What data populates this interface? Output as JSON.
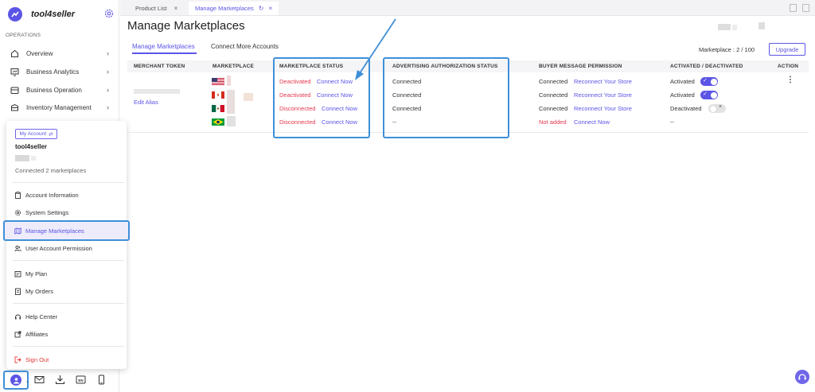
{
  "brand": {
    "name": "tool4seller"
  },
  "sidebar": {
    "section_label": "OPERATIONS",
    "items": [
      {
        "label": "Overview",
        "icon": "home-icon"
      },
      {
        "label": "Business Analytics",
        "icon": "analytics-icon"
      },
      {
        "label": "Business Operation",
        "icon": "operation-icon"
      },
      {
        "label": "Inventory Management",
        "icon": "inventory-icon"
      }
    ]
  },
  "account_menu": {
    "my_account_label": "My Account",
    "account_name": "tool4seller",
    "connected_text": "Connected 2 marketplaces",
    "items": [
      {
        "label": "Account Information",
        "icon": "clipboard-icon"
      },
      {
        "label": "System Settings",
        "icon": "gear-icon"
      },
      {
        "label": "Manage Marketplaces",
        "icon": "map-icon",
        "active": true
      },
      {
        "label": "User Account Permission",
        "icon": "users-icon"
      },
      {
        "label": "My Plan",
        "icon": "plan-icon"
      },
      {
        "label": "My Orders",
        "icon": "orders-icon"
      },
      {
        "label": "Help Center",
        "icon": "help-icon"
      },
      {
        "label": "Affiliates",
        "icon": "external-link-icon"
      },
      {
        "label": "Sign Out",
        "icon": "sign-out-icon"
      }
    ]
  },
  "tabs": [
    {
      "label": "Product List",
      "active": false
    },
    {
      "label": "Manage Marketplaces",
      "active": true
    }
  ],
  "page": {
    "title": "Manage Marketplaces",
    "subtabs": [
      "Manage Marketplaces",
      "Connect More Accounts"
    ],
    "marketplace_count": "Marketplace : 2 / 100",
    "upgrade_label": "Upgrade"
  },
  "table": {
    "headers": [
      "MERCHANT TOKEN",
      "MARKETPLACE",
      "MARKETPLACE STATUS",
      "ADVERTISING AUTHORIZATION STATUS",
      "BUYER MESSAGE PERMISSION",
      "ACTIVATED / DEACTIVATED",
      "ACTION"
    ],
    "edit_alias": "Edit Alias",
    "rows": [
      {
        "flag": "US",
        "status": "Deactivated",
        "status_link": "Connect Now",
        "ad_status": "Connected",
        "buyer_status": "Connected",
        "buyer_link": "Reconnect Your Store",
        "active_label": "Activated",
        "toggle": "on"
      },
      {
        "flag": "CA",
        "status": "Deactivated",
        "status_link": "Connect Now",
        "ad_status": "Connected",
        "buyer_status": "Connected",
        "buyer_link": "Reconnect Your Store",
        "active_label": "Activated",
        "toggle": "on"
      },
      {
        "flag": "MX",
        "status": "Disconnected",
        "status_link": "Connect Now",
        "ad_status": "Connected",
        "buyer_status": "Connected",
        "buyer_link": "Reconnect Your Store",
        "active_label": "Deactivated",
        "toggle": "off"
      },
      {
        "flag": "BR",
        "status": "Disconnected",
        "status_link": "Connect Now",
        "ad_status": "--",
        "buyer_status": "Not added",
        "buyer_link": "Connect Now",
        "active_label": "--",
        "toggle": "none"
      }
    ]
  },
  "colors": {
    "accent": "#5b55e6",
    "danger": "#e53950",
    "highlight": "#3f8fd8"
  }
}
